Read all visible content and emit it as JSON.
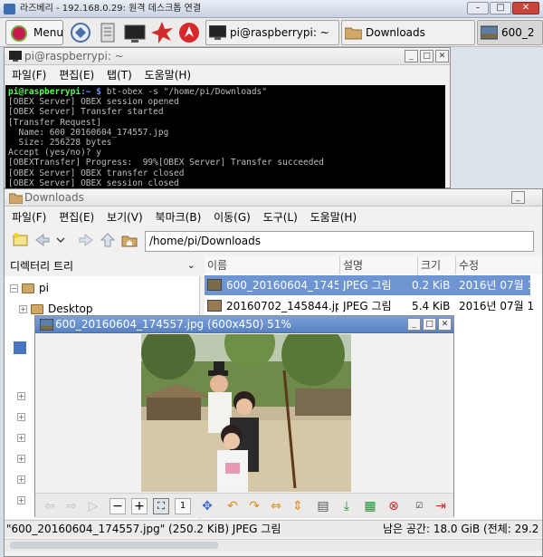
{
  "rdp": {
    "title": "라즈베리 - 192.168.0.29: 원격 데스크톱 연결",
    "min": "–",
    "max": "□",
    "close": "✕"
  },
  "panel": {
    "menu_label": "Menu",
    "tasks": [
      {
        "label": "pi@raspberrypi: ~"
      },
      {
        "label": "Downloads"
      },
      {
        "label": "600_2"
      }
    ]
  },
  "terminal": {
    "title": "pi@raspberrypi: ~",
    "menus": [
      "파일(F)",
      "편집(E)",
      "탭(T)",
      "도움말(H)"
    ],
    "prompt_user": "pi@raspberrypi",
    "prompt_path": ":~ $",
    "command": " bt-obex -s \"/home/pi/Downloads\"",
    "lines": [
      "[OBEX Server] OBEX session opened",
      "[OBEX Server] Transfer started",
      "[Transfer Request]",
      "  Name: 600_20160604_174557.jpg",
      "  Size: 256228 bytes",
      "Accept (yes/no)? y",
      "[OBEXTransfer] Progress:  99%[OBEX Server] Transfer succeeded",
      "[OBEX Server] OBEX transfer closed",
      "[OBEX Server] OBEX session closed"
    ]
  },
  "filemgr": {
    "title": "Downloads",
    "menus": [
      "파일(F)",
      "편집(E)",
      "보기(V)",
      "북마크(B)",
      "이동(G)",
      "도구(L)",
      "도움말(H)"
    ],
    "address": "/home/pi/Downloads",
    "tree_header": "디렉터리 트리",
    "tree_root": "pi",
    "tree_items": [
      "Desktop"
    ],
    "columns": [
      "이름",
      "설명",
      "크기",
      "수정"
    ],
    "files": [
      {
        "name": "600_20160604_1745…",
        "desc": "JPEG 그림",
        "size": "0.2 KiB",
        "mod": "2016년 07월 17"
      },
      {
        "name": "20160702_145844.jpg",
        "desc": "JPEG 그림",
        "size": "5.4 KiB",
        "mod": "2016년 07월 1"
      }
    ],
    "status_left": "\"600_20160604_174557.jpg\" (250.2 KiB) JPEG 그림",
    "status_right": "남은 공간: 18.0 GiB (전체: 29.2"
  },
  "viewer": {
    "title": "600_20160604_174557.jpg (600x450) 51%"
  }
}
